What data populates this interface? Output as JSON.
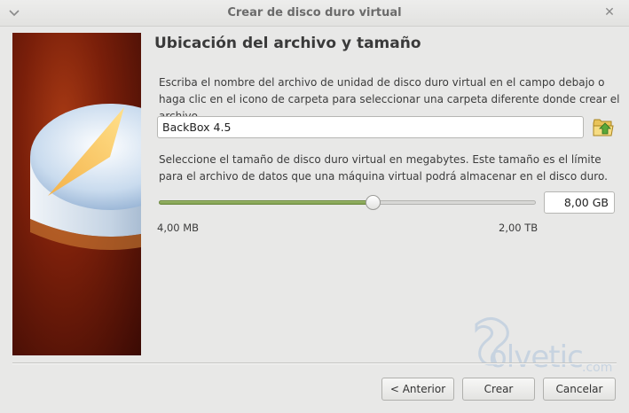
{
  "window": {
    "title": "Crear de disco duro virtual",
    "close_glyph": "✕",
    "icons": [
      "window-menu-icon",
      "close-icon"
    ]
  },
  "page": {
    "heading": "Ubicación del archivo y tamaño",
    "location_description": "Escriba el nombre del archivo de unidad de disco duro virtual en el campo debajo o haga clic en el icono de carpeta para seleccionar una carpeta diferente donde crear el archivo.",
    "file_name_value": "BackBox 4.5",
    "folder_icon": "folder-open-icon",
    "size_description": "Seleccione el tamaño de disco duro virtual en megabytes. Este tamaño es el límite para el archivo de datos que una máquina virtual podrá almacenar en el disco duro.",
    "size_slider": {
      "min_label": "4,00 MB",
      "max_label": "2,00 TB",
      "value_fraction": 0.57
    },
    "size_value": "8,00 GB"
  },
  "watermark": {
    "text": "olvetic",
    "suffix": ".com",
    "color": "#c7d3e0"
  },
  "buttons": {
    "back": "< Anterior",
    "create": "Crear",
    "cancel": "Cancelar"
  },
  "colors": {
    "banner_red": "#7a1f0a",
    "slider_green": "#8aa85a"
  }
}
